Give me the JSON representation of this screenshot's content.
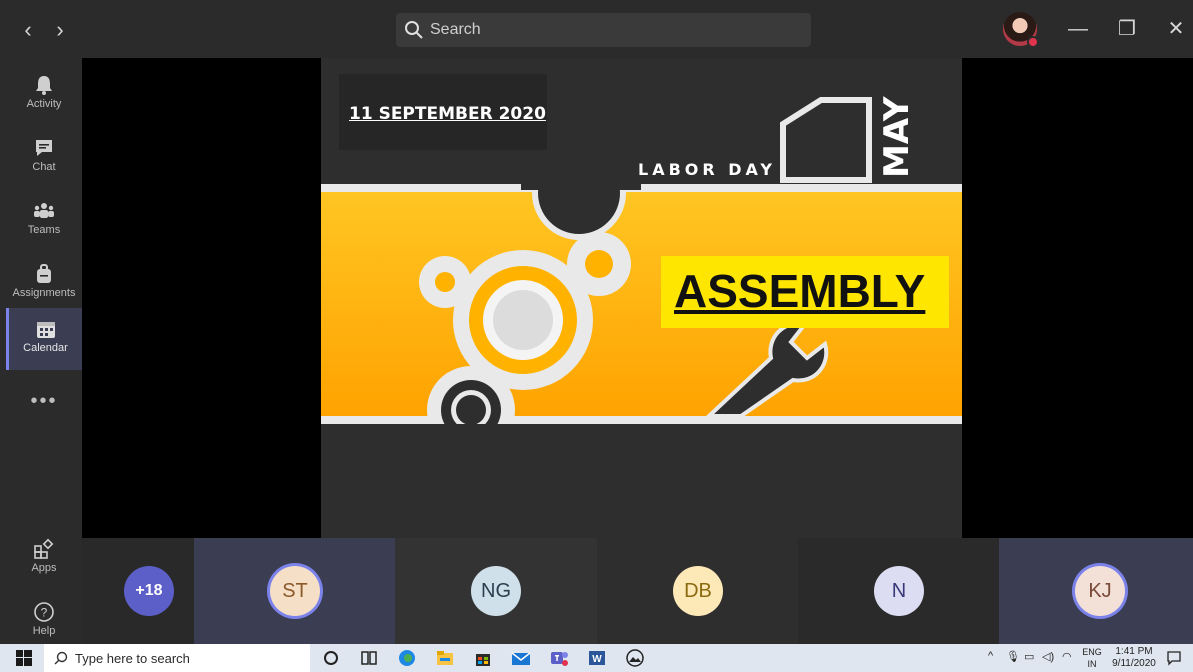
{
  "window": {
    "back": "‹",
    "forward": "›",
    "minimize": "—",
    "maximize": "❐",
    "close": "✕"
  },
  "search": {
    "placeholder": "Search"
  },
  "rail": {
    "items": [
      {
        "label": "Activity"
      },
      {
        "label": "Chat"
      },
      {
        "label": "Teams"
      },
      {
        "label": "Assignments"
      },
      {
        "label": "Calendar"
      },
      {
        "label": "Apps"
      },
      {
        "label": "Help"
      }
    ],
    "more": "•••"
  },
  "slide": {
    "date": "11 SEPTEMBER 2020",
    "event": "LABOR DAY",
    "month": "MAY",
    "title": "ASSEMBLY"
  },
  "participants": {
    "overflow": "+18",
    "tiles": [
      {
        "initials": "ST",
        "bg": "#f5dfc6",
        "fg": "#8a5a2b",
        "ring": true
      },
      {
        "initials": "NG",
        "bg": "#cfe0ea",
        "fg": "#2c3e50",
        "ring": false
      },
      {
        "initials": "DB",
        "bg": "#fde9b8",
        "fg": "#8a6a10",
        "ring": false
      },
      {
        "initials": "N",
        "bg": "#dcdcf2",
        "fg": "#3a3a7a",
        "ring": false
      },
      {
        "initials": "KJ",
        "bg": "#f3e0d6",
        "fg": "#7a4a3a",
        "ring": true
      }
    ]
  },
  "taskbar": {
    "search_placeholder": "Type here to search",
    "lang_line1": "ENG",
    "lang_line2": "IN",
    "time": "1:41 PM",
    "date": "9/11/2020"
  },
  "colors": {
    "accent": "#7b83eb",
    "slide_yellow": "#ffb300",
    "assembly_highlight": "#ffe600"
  }
}
